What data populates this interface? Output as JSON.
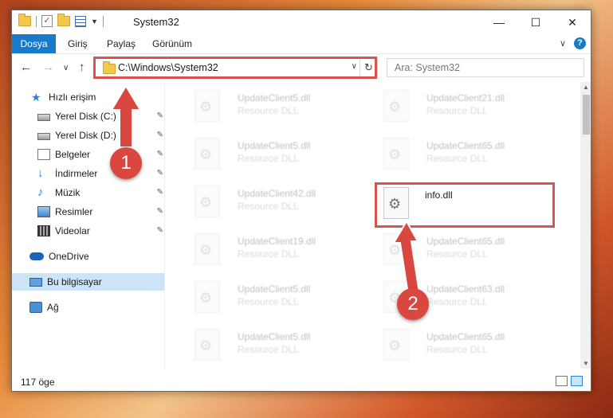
{
  "window": {
    "title": "System32",
    "controls": {
      "minimize": "—",
      "maximize": "☐",
      "close": "✕"
    }
  },
  "ribbon": {
    "tabs": [
      "Dosya",
      "Giriş",
      "Paylaş",
      "Görünüm"
    ]
  },
  "nav": {
    "address": "C:\\Windows\\System32",
    "search_placeholder": "Ara: System32"
  },
  "sidebar": {
    "items": [
      {
        "label": "Hızlı erişim",
        "icon": "star-icon"
      },
      {
        "label": "Yerel Disk (C:)",
        "icon": "disk-icon",
        "pinned": true
      },
      {
        "label": "Yerel Disk (D:)",
        "icon": "disk-icon",
        "pinned": true
      },
      {
        "label": "Belgeler",
        "icon": "documents-icon",
        "pinned": true
      },
      {
        "label": "İndirmeler",
        "icon": "download-icon",
        "pinned": true
      },
      {
        "label": "Müzik",
        "icon": "music-icon",
        "pinned": true
      },
      {
        "label": "Resimler",
        "icon": "pictures-icon",
        "pinned": true
      },
      {
        "label": "Videolar",
        "icon": "video-icon",
        "pinned": true
      },
      {
        "label": "OneDrive",
        "icon": "onedrive-icon"
      },
      {
        "label": "Bu bilgisayar",
        "icon": "computer-icon",
        "selected": true
      },
      {
        "label": "Ağ",
        "icon": "network-icon"
      }
    ]
  },
  "files": {
    "col1": [
      {
        "name": "UpdateClient5.dll",
        "desc": "Resource DLL"
      },
      {
        "name": "UpdateClient5.dll",
        "desc": "Resource DLL"
      },
      {
        "name": "UpdateClient42.dll",
        "desc": "Resource DLL"
      },
      {
        "name": "UpdateClient19.dll",
        "desc": "Resource DLL"
      },
      {
        "name": "UpdateClient5.dll",
        "desc": "Resource DLL"
      },
      {
        "name": "UpdateClient5.dll",
        "desc": "Resource DLL"
      }
    ],
    "col2": [
      {
        "name": "UpdateClient21.dll",
        "desc": "Resource DLL"
      },
      {
        "name": "UpdateClient65.dll",
        "desc": "Resource DLL"
      },
      {
        "name": "info.dll",
        "desc": ""
      },
      {
        "name": "UpdateClient65.dll",
        "desc": "Resource DLL"
      },
      {
        "name": "UpdateClient63.dll",
        "desc": "Resource DLL"
      },
      {
        "name": "UpdateClient65.dll",
        "desc": "Resource DLL"
      }
    ]
  },
  "status": {
    "count": "117 öge"
  },
  "annotations": {
    "step1": "1",
    "step2": "2",
    "color": "#d9473f"
  }
}
